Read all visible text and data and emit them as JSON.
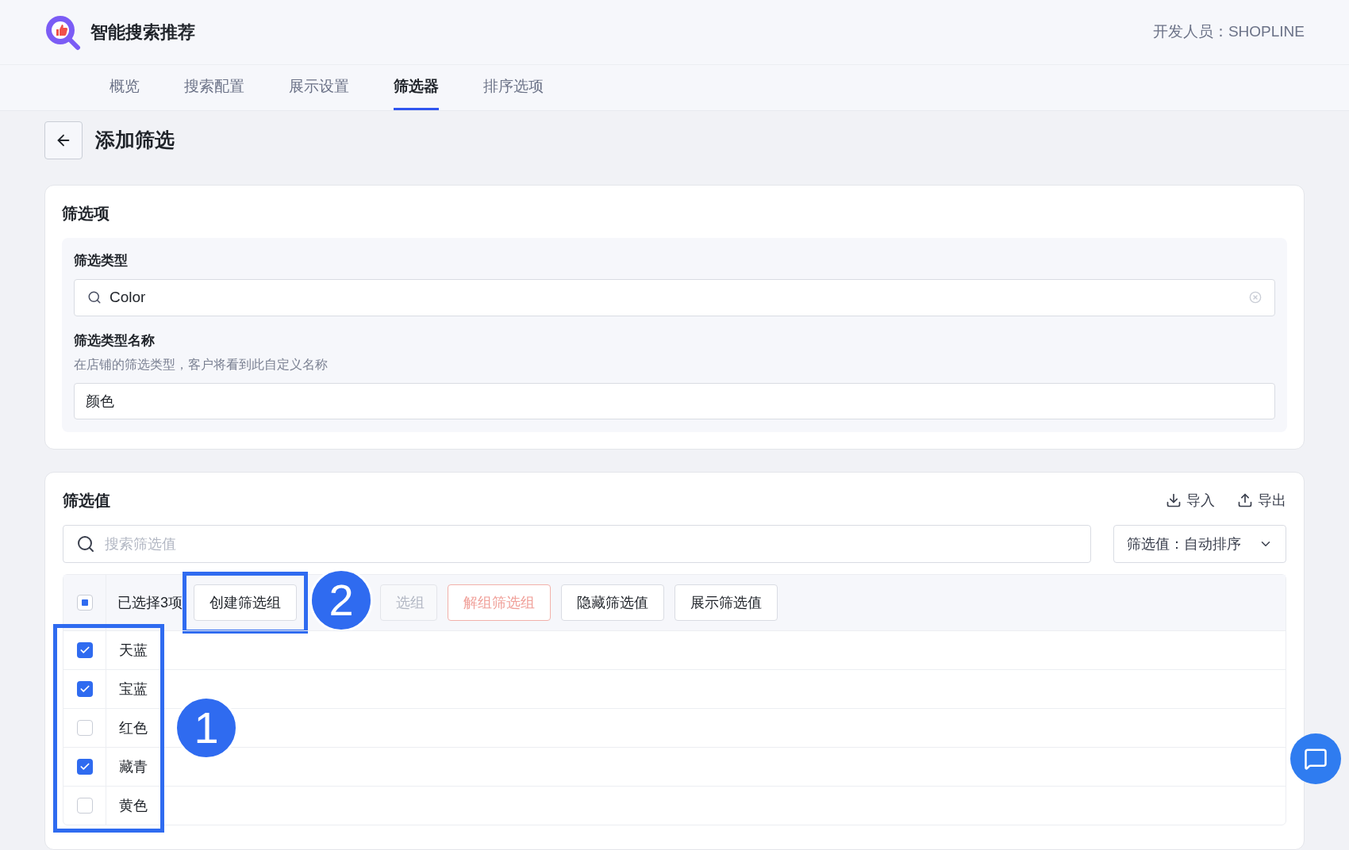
{
  "header": {
    "app_name": "智能搜索推荐",
    "developer": "开发人员：SHOPLINE"
  },
  "tabs": [
    {
      "label": "概览",
      "selected": false
    },
    {
      "label": "搜索配置",
      "selected": false
    },
    {
      "label": "展示设置",
      "selected": false
    },
    {
      "label": "筛选器",
      "selected": true
    },
    {
      "label": "排序选项",
      "selected": false
    }
  ],
  "page_title": "添加筛选",
  "filter_item": {
    "title": "筛选项",
    "type_label": "筛选类型",
    "type_value": "Color",
    "name_label": "筛选类型名称",
    "name_hint": "在店铺的筛选类型，客户将看到此自定义名称",
    "name_value": "颜色"
  },
  "filter_values": {
    "title": "筛选值",
    "actions": [
      {
        "label": "导入",
        "kind": "import"
      },
      {
        "label": "导出",
        "kind": "export"
      }
    ],
    "search_placeholder": "搜索筛选值",
    "sort": "筛选值：自动排序",
    "header_checkbox_partial": true,
    "selection_count": "已选择3项",
    "bulk_buttons": [
      {
        "label": "创建筛选组",
        "kind": "default",
        "disabled": false
      },
      {
        "label": "选组",
        "kind": "default",
        "disabled": true
      },
      {
        "label": "解组筛选组",
        "kind": "danger",
        "disabled": true
      },
      {
        "label": "隐藏筛选值",
        "kind": "default",
        "disabled": false
      },
      {
        "label": "展示筛选值",
        "kind": "default",
        "disabled": false
      }
    ],
    "rows": [
      {
        "name": "天蓝",
        "checked": true
      },
      {
        "name": "宝蓝",
        "checked": true
      },
      {
        "name": "红色",
        "checked": false
      },
      {
        "name": "藏青",
        "checked": true
      },
      {
        "name": "黄色",
        "checked": false
      }
    ]
  },
  "callouts": [
    {
      "number": "1"
    },
    {
      "number": "2"
    }
  ]
}
